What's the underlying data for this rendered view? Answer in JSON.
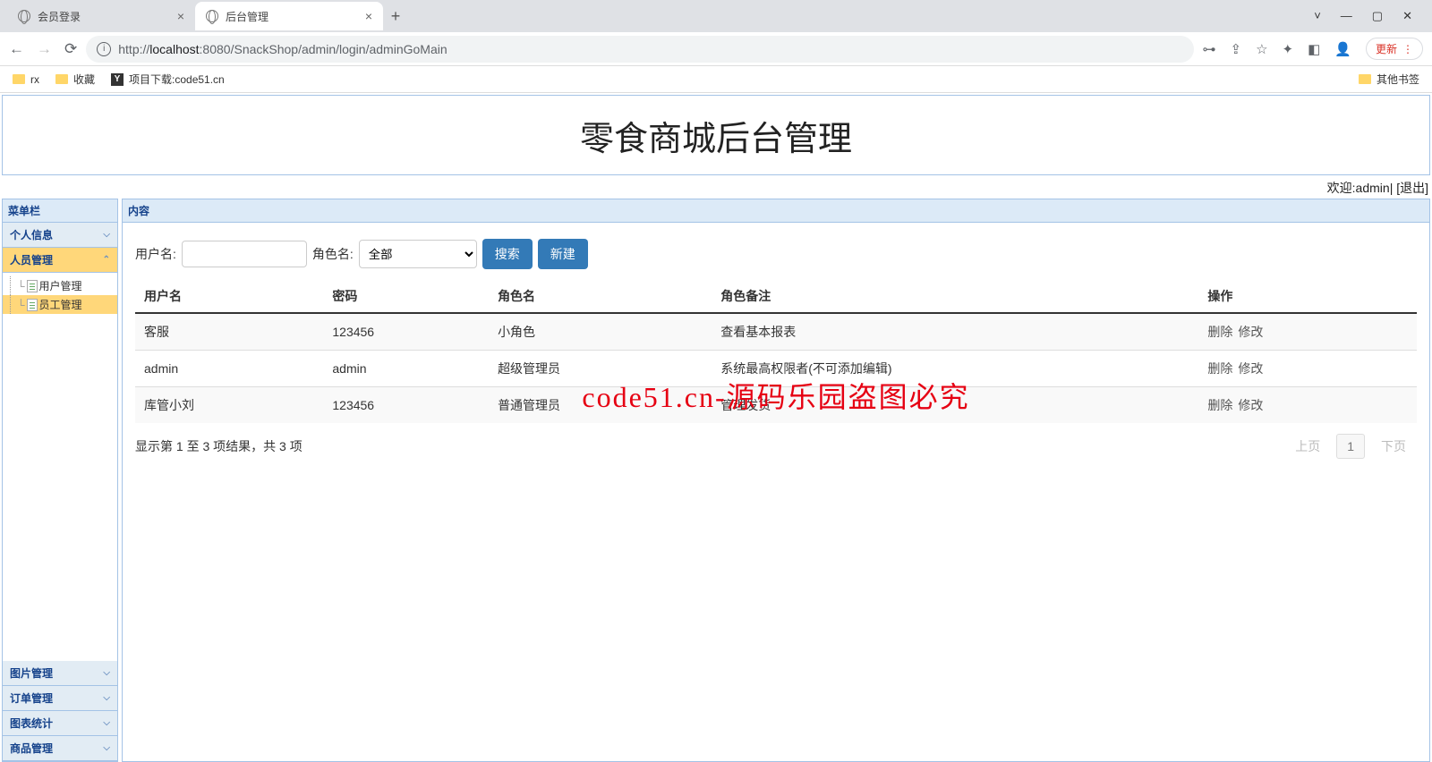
{
  "browser": {
    "tabs": [
      {
        "title": "会员登录"
      },
      {
        "title": "后台管理"
      }
    ],
    "url_host_prefix": "http://",
    "url_host": "localhost",
    "url_port": ":8080",
    "url_path": "/SnackShop/admin/login/adminGoMain",
    "update_label": "更新",
    "bookmarks": {
      "rx": "rx",
      "fav": "收藏",
      "project": "项目下载:code51.cn",
      "other": "其他书签"
    }
  },
  "header": {
    "title": "零食商城后台管理",
    "welcome_prefix": "欢迎:",
    "welcome_user": "admin",
    "logout": "[退出]"
  },
  "sidebar": {
    "title": "菜单栏",
    "items": [
      {
        "label": "个人信息"
      },
      {
        "label": "人员管理"
      },
      {
        "label": "图片管理"
      },
      {
        "label": "订单管理"
      },
      {
        "label": "图表统计"
      },
      {
        "label": "商品管理"
      }
    ],
    "tree": [
      {
        "label": "用户管理"
      },
      {
        "label": "员工管理"
      }
    ]
  },
  "content": {
    "title": "内容",
    "filter": {
      "username_label": "用户名:",
      "role_label": "角色名:",
      "role_all": "全部",
      "search": "搜索",
      "new": "新建"
    },
    "columns": {
      "username": "用户名",
      "password": "密码",
      "role": "角色名",
      "remark": "角色备注",
      "ops": "操作"
    },
    "rows": [
      {
        "username": "客服",
        "password": "123456",
        "role": "小角色",
        "remark": "查看基本报表"
      },
      {
        "username": "admin",
        "password": "admin",
        "role": "超级管理员",
        "remark": "系统最高权限者(不可添加编辑)"
      },
      {
        "username": "库管小刘",
        "password": "123456",
        "role": "普通管理员",
        "remark": "管理发货"
      }
    ],
    "ops": {
      "delete": "删除",
      "edit": "修改"
    },
    "summary": "显示第 1 至 3 项结果，共 3 项",
    "pager": {
      "prev": "上页",
      "page": "1",
      "next": "下页"
    }
  },
  "watermark": "code51.cn-源码乐园盗图必究"
}
